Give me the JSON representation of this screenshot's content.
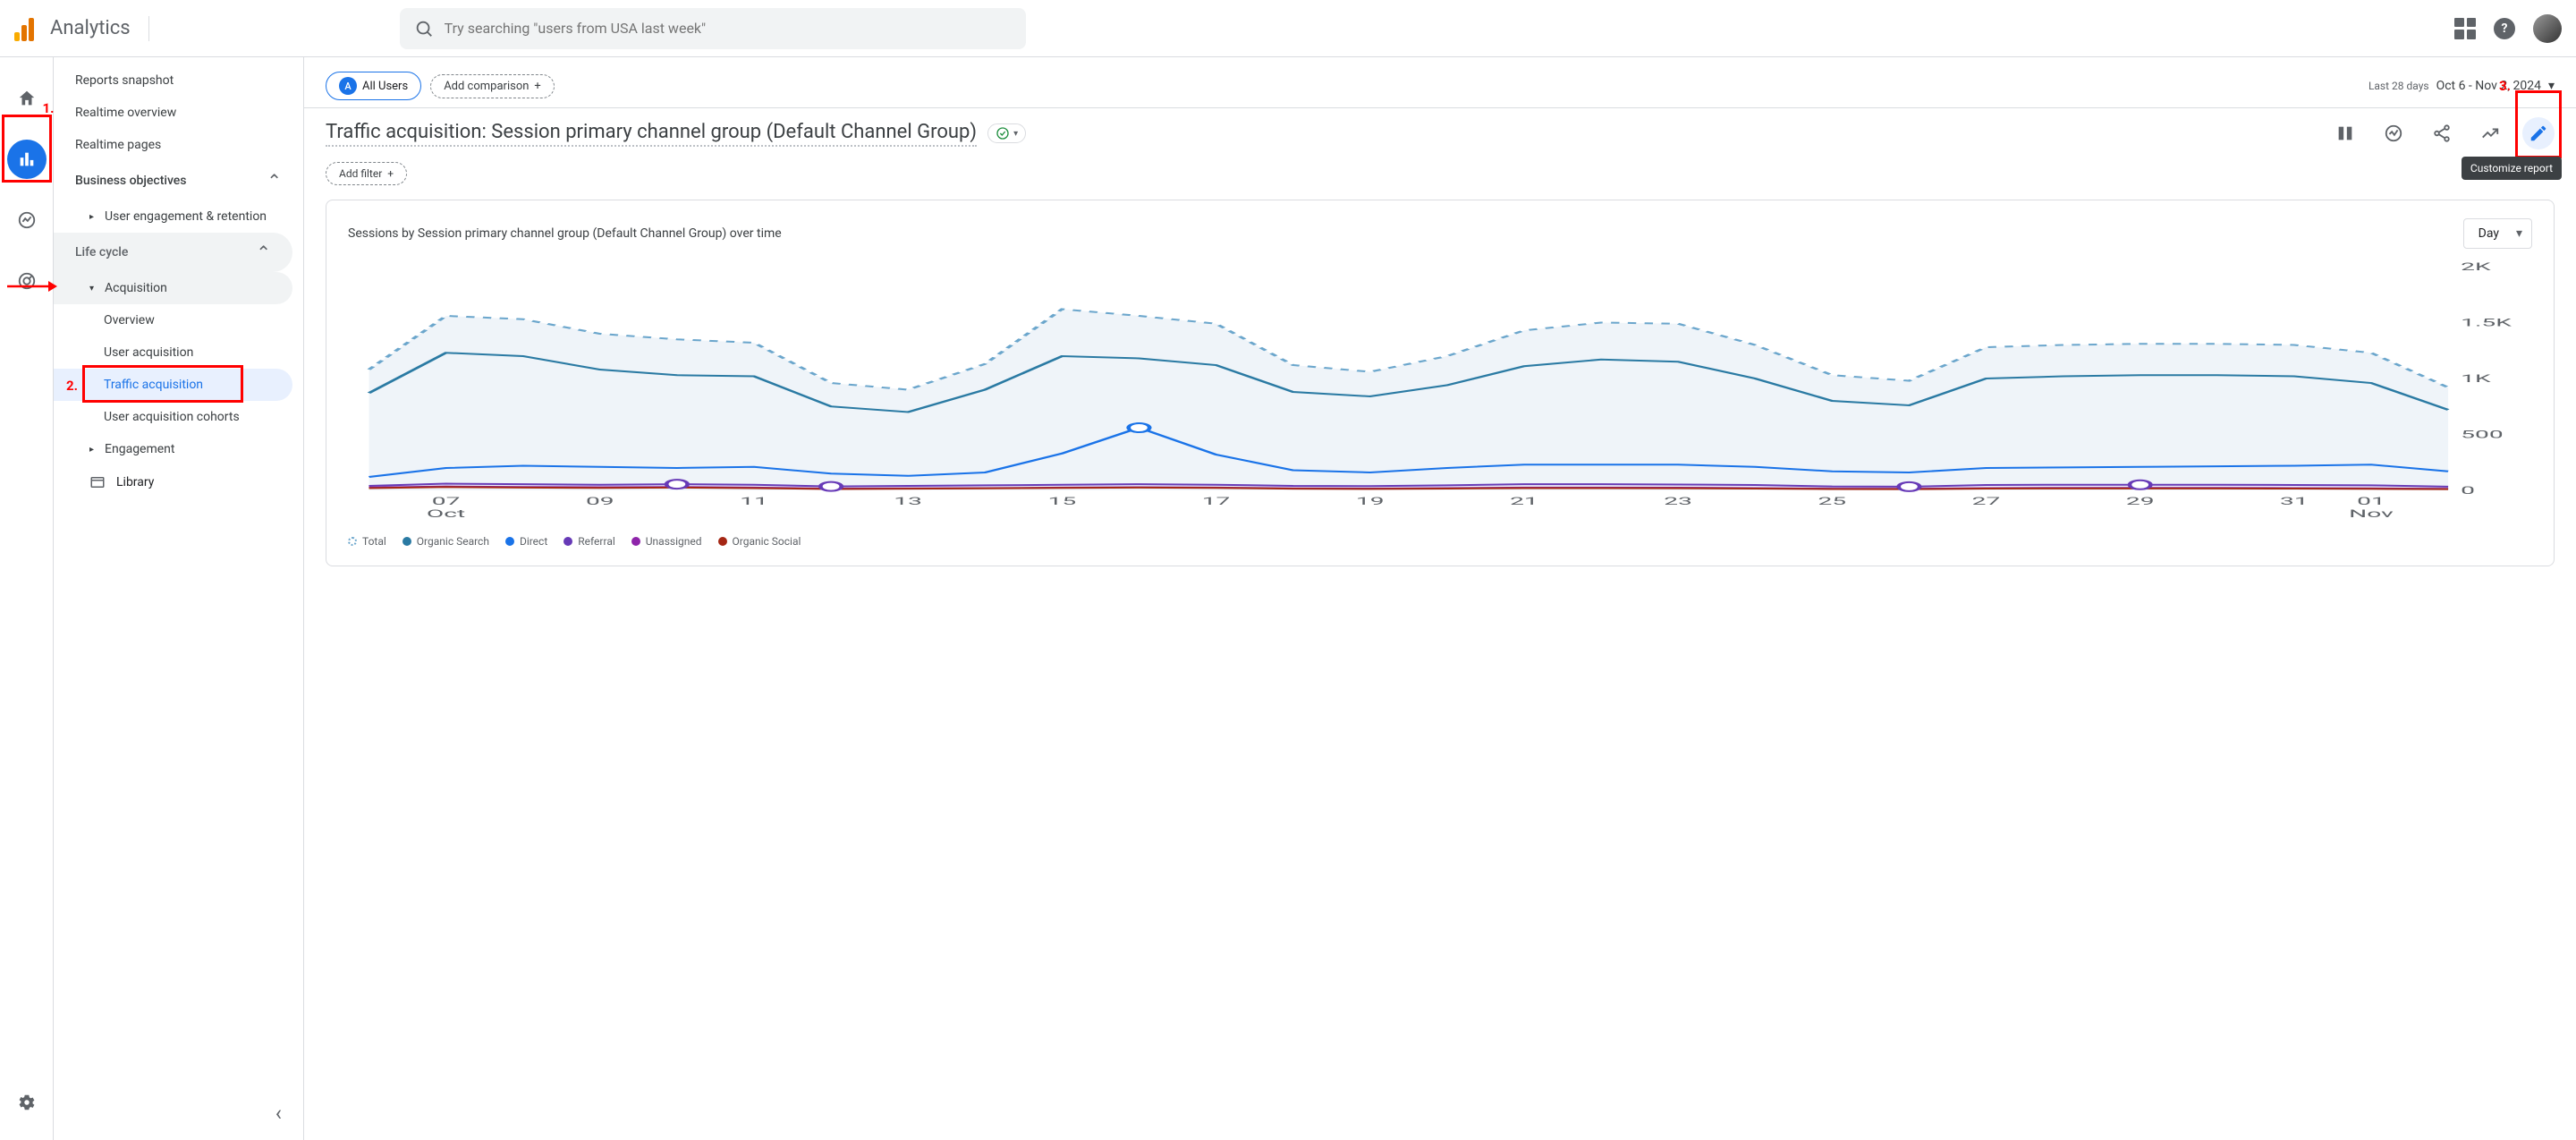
{
  "header": {
    "app_name": "Analytics",
    "search_placeholder": "Try searching \"users from USA last week\""
  },
  "sidebar": {
    "reports_snapshot": "Reports snapshot",
    "realtime_overview": "Realtime overview",
    "realtime_pages": "Realtime pages",
    "business_objectives": "Business objectives",
    "user_engagement": "User engagement & retention",
    "life_cycle": "Life cycle",
    "acquisition": "Acquisition",
    "overview": "Overview",
    "user_acquisition": "User acquisition",
    "traffic_acquisition": "Traffic acquisition",
    "user_acquisition_cohorts": "User acquisition cohorts",
    "engagement": "Engagement",
    "library": "Library"
  },
  "controls": {
    "all_users_badge": "A",
    "all_users": "All Users",
    "add_comparison": "Add comparison",
    "date_prefix": "Last 28 days",
    "date_range": "Oct 6 - Nov 2, 2024",
    "add_filter": "Add filter"
  },
  "report": {
    "title": "Traffic acquisition: Session primary channel group (Default Channel Group)",
    "tooltip_customize": "Customize report"
  },
  "chart": {
    "title": "Sessions by Session primary channel group (Default Channel Group) over time",
    "granularity": "Day",
    "legend": {
      "total": "Total",
      "organic_search": "Organic Search",
      "direct": "Direct",
      "referral": "Referral",
      "unassigned": "Unassigned",
      "organic_social": "Organic Social"
    }
  },
  "annotations": {
    "one": "1.",
    "two": "2.",
    "three": "3."
  },
  "chart_data": {
    "type": "line",
    "xlabel": "",
    "ylabel": "",
    "ylim": [
      0,
      2000
    ],
    "y_ticks": [
      "0",
      "500",
      "1K",
      "1.5K",
      "2K"
    ],
    "x_ticks": [
      "07",
      "09",
      "11",
      "13",
      "15",
      "17",
      "19",
      "21",
      "23",
      "25",
      "27",
      "29",
      "31",
      "01"
    ],
    "x_sublabels": {
      "07": "Oct",
      "01": "Nov"
    },
    "categories": [
      "06",
      "07",
      "08",
      "09",
      "10",
      "11",
      "12",
      "13",
      "14",
      "15",
      "16",
      "17",
      "18",
      "19",
      "20",
      "21",
      "22",
      "23",
      "24",
      "25",
      "26",
      "27",
      "28",
      "29",
      "30",
      "31",
      "01",
      "02"
    ],
    "series": [
      {
        "name": "Total",
        "style": "dashed",
        "color": "#6ba6cc",
        "values": [
          1080,
          1560,
          1530,
          1400,
          1350,
          1320,
          960,
          900,
          1130,
          1620,
          1560,
          1490,
          1120,
          1060,
          1200,
          1430,
          1500,
          1490,
          1300,
          1030,
          980,
          1280,
          1300,
          1310,
          1310,
          1300,
          1230,
          920
        ]
      },
      {
        "name": "Organic Search",
        "style": "solid",
        "color": "#2a7aa3",
        "values": [
          870,
          1230,
          1200,
          1080,
          1030,
          1020,
          750,
          700,
          900,
          1200,
          1180,
          1120,
          880,
          840,
          940,
          1110,
          1170,
          1150,
          1000,
          800,
          760,
          1000,
          1020,
          1030,
          1030,
          1020,
          960,
          720
        ]
      },
      {
        "name": "Direct",
        "style": "solid",
        "color": "#1a73e8",
        "values": [
          120,
          200,
          220,
          210,
          200,
          210,
          150,
          130,
          160,
          330,
          560,
          320,
          180,
          160,
          200,
          230,
          230,
          230,
          210,
          170,
          160,
          200,
          205,
          210,
          215,
          220,
          230,
          170
        ]
      },
      {
        "name": "Referral",
        "style": "solid",
        "color": "#673ab7",
        "values": [
          40,
          60,
          55,
          50,
          55,
          50,
          35,
          40,
          45,
          50,
          55,
          50,
          40,
          38,
          45,
          55,
          55,
          52,
          48,
          35,
          33,
          48,
          50,
          50,
          50,
          48,
          45,
          33
        ]
      },
      {
        "name": "Unassigned",
        "style": "solid",
        "color": "#8e24aa",
        "values": [
          25,
          35,
          30,
          28,
          30,
          25,
          15,
          18,
          20,
          25,
          28,
          25,
          18,
          16,
          20,
          25,
          25,
          24,
          20,
          15,
          14,
          20,
          22,
          22,
          22,
          20,
          18,
          14
        ]
      },
      {
        "name": "Organic Social",
        "style": "solid",
        "color": "#a52714",
        "values": [
          20,
          30,
          25,
          22,
          25,
          20,
          12,
          15,
          18,
          22,
          25,
          22,
          15,
          13,
          16,
          20,
          20,
          19,
          16,
          12,
          11,
          16,
          17,
          17,
          17,
          16,
          14,
          11
        ]
      }
    ],
    "markers": [
      {
        "series": "Direct",
        "x_index": 10
      },
      {
        "series": "Referral",
        "x_index": 4
      },
      {
        "series": "Referral",
        "x_index": 6
      },
      {
        "series": "Referral",
        "x_index": 20
      },
      {
        "series": "Referral",
        "x_index": 23
      }
    ]
  }
}
